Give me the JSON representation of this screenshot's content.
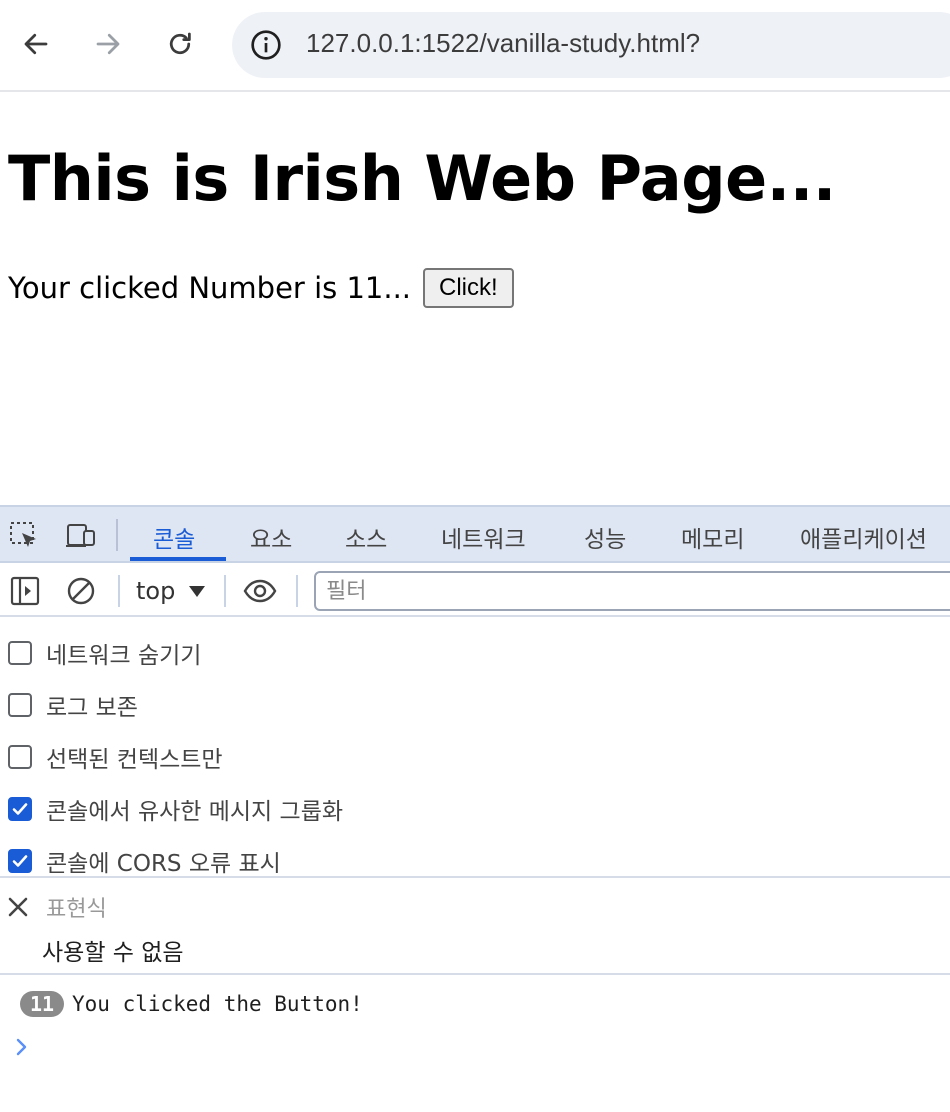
{
  "browser": {
    "url": "127.0.0.1:1522/vanilla-study.html?"
  },
  "page": {
    "title": "This is Irish Web Page...",
    "click_text": "Your clicked Number is 11...",
    "button_label": "Click!"
  },
  "devtools": {
    "tabs": [
      {
        "label": "콘솔",
        "active": true
      },
      {
        "label": "요소",
        "active": false
      },
      {
        "label": "소스",
        "active": false
      },
      {
        "label": "네트워크",
        "active": false
      },
      {
        "label": "성능",
        "active": false
      },
      {
        "label": "메모리",
        "active": false
      },
      {
        "label": "애플리케이션",
        "active": false
      }
    ],
    "context": "top",
    "filter_placeholder": "필터",
    "settings": [
      {
        "label": "네트워크 숨기기",
        "checked": false
      },
      {
        "label": "로그 보존",
        "checked": false
      },
      {
        "label": "선택된 컨텍스트만",
        "checked": false
      },
      {
        "label": "콘솔에서 유사한 메시지 그룹화",
        "checked": true
      },
      {
        "label": "콘솔에 CORS 오류 표시",
        "checked": true
      }
    ],
    "expression": {
      "placeholder": "표현식",
      "value": "사용할 수 없음"
    },
    "log": {
      "count": "11",
      "message": "You clicked the Button!"
    },
    "colors": {
      "accent": "#1a5bd6",
      "tab_bar_bg": "#dfe6f3"
    }
  }
}
